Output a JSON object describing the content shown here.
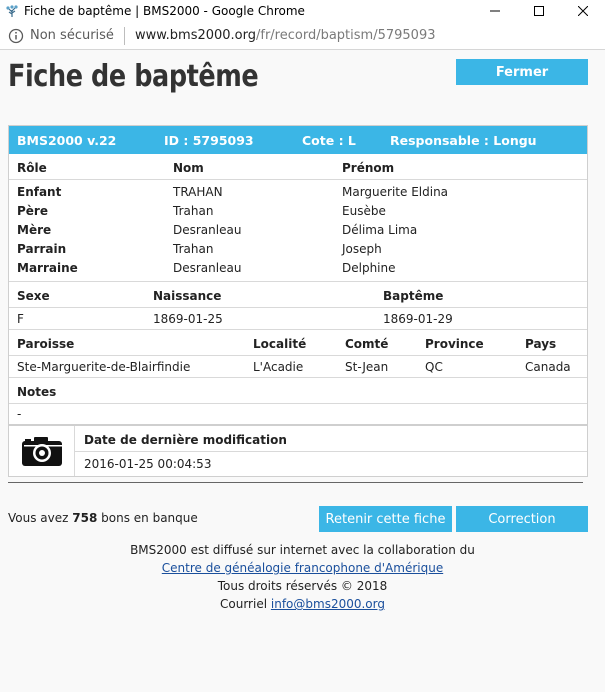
{
  "window": {
    "title": "Fiche de baptême | BMS2000 - Google Chrome"
  },
  "address": {
    "security": "Non sécurisé",
    "host": "www.bms2000.org",
    "path": "/fr/record/baptism/5795093"
  },
  "page": {
    "heading": "Fiche de baptême",
    "close_label": "Fermer"
  },
  "record_header": {
    "version": "BMS2000 v.22",
    "id": "ID : 5795093",
    "cote": "Cote : L",
    "responsable": "Responsable : Longu"
  },
  "persons": {
    "headers": {
      "role": "Rôle",
      "nom": "Nom",
      "prenom": "Prénom"
    },
    "rows": [
      {
        "role": "Enfant",
        "nom": "TRAHAN",
        "prenom": "Marguerite Eldina"
      },
      {
        "role": "Père",
        "nom": "Trahan",
        "prenom": "Eusèbe"
      },
      {
        "role": "Mère",
        "nom": "Desranleau",
        "prenom": "Délima Lima"
      },
      {
        "role": "Parrain",
        "nom": "Trahan",
        "prenom": "Joseph"
      },
      {
        "role": "Marraine",
        "nom": "Desranleau",
        "prenom": "Delphine"
      }
    ]
  },
  "vital": {
    "headers": {
      "sexe": "Sexe",
      "naissance": "Naissance",
      "bapteme": "Baptême"
    },
    "values": {
      "sexe": "F",
      "naissance": "1869-01-25",
      "bapteme": "1869-01-29"
    }
  },
  "place": {
    "headers": {
      "paroisse": "Paroisse",
      "localite": "Localité",
      "comte": "Comté",
      "province": "Province",
      "pays": "Pays"
    },
    "values": {
      "paroisse": "Ste-Marguerite-de-Blairfindie",
      "localite": "L'Acadie",
      "comte": "St-Jean",
      "province": "QC",
      "pays": "Canada"
    }
  },
  "notes": {
    "header": "Notes",
    "value": "-"
  },
  "modification": {
    "header": "Date de dernière modification",
    "value": "2016-01-25 00:04:53"
  },
  "bank": {
    "prefix": "Vous avez",
    "count": "758",
    "suffix": "bons en banque"
  },
  "actions": {
    "retain_label": "Retenir cette fiche",
    "correction_label": "Correction"
  },
  "footer": {
    "line1": "BMS2000 est diffusé sur internet avec la collaboration du",
    "link": "Centre de généalogie francophone d'Amérique",
    "rights": "Tous droits réservés © 2018",
    "email_prefix": "Courriel",
    "email": "info@bms2000.org"
  },
  "colors": {
    "accent": "#3bb6e6",
    "link": "#1a4f9c"
  }
}
